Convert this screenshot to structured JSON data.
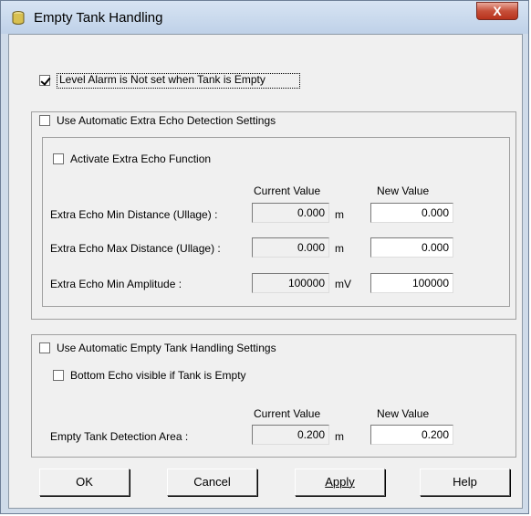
{
  "window": {
    "title": "Empty Tank Handling",
    "close_label": "X"
  },
  "level_alarm": {
    "label": "Level Alarm is Not set when Tank is Empty",
    "checked": true
  },
  "extra_echo_auto": {
    "label": "Use Automatic Extra Echo Detection Settings",
    "checked": false
  },
  "extra_echo": {
    "activate_label": "Activate Extra Echo Function",
    "current_header": "Current Value",
    "new_header": "New Value",
    "rows": [
      {
        "label": "Extra Echo Min Distance (Ullage) :",
        "current": "0.000",
        "unit": "m",
        "new": "0.000"
      },
      {
        "label": "Extra Echo Max Distance (Ullage) :",
        "current": "0.000",
        "unit": "m",
        "new": "0.000"
      },
      {
        "label": "Extra Echo Min Amplitude :",
        "current": "100000",
        "unit": "mV",
        "new": "100000"
      }
    ]
  },
  "empty_tank": {
    "auto_label": "Use Automatic Empty Tank Handling Settings",
    "bottom_echo_label": "Bottom Echo visible if Tank is Empty",
    "current_header": "Current Value",
    "new_header": "New Value",
    "area_label": "Empty Tank Detection Area :",
    "area_current": "0.200",
    "area_unit": "m",
    "area_new": "0.200"
  },
  "buttons": {
    "ok": "OK",
    "cancel": "Cancel",
    "apply": "Apply",
    "help": "Help"
  }
}
